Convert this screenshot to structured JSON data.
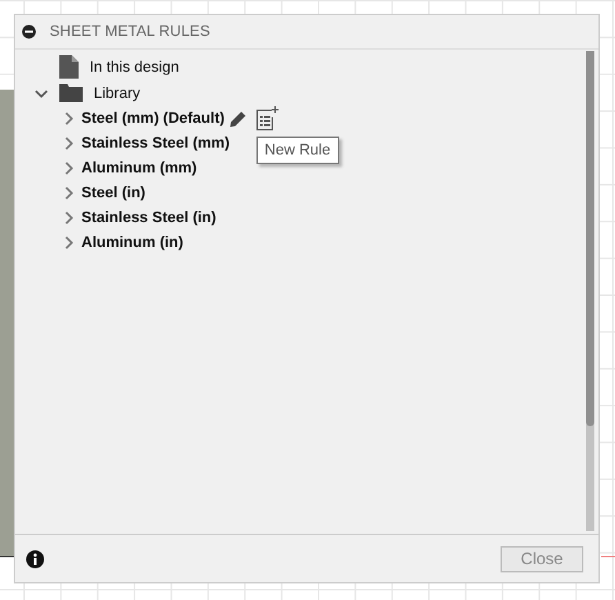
{
  "dialog": {
    "title": "SHEET METAL RULES"
  },
  "tree": [
    {
      "kind": "document",
      "label": "In this design"
    },
    {
      "kind": "folder",
      "label": "Library",
      "expanded": true,
      "children": [
        {
          "label": "Steel (mm) (Default)",
          "expanded": false,
          "hovered": true
        },
        {
          "label": "Stainless Steel (mm)",
          "expanded": false,
          "hovered": false
        },
        {
          "label": "Aluminum (mm)",
          "expanded": false,
          "hovered": false
        },
        {
          "label": "Steel (in)",
          "expanded": false,
          "hovered": false
        },
        {
          "label": "Stainless Steel (in)",
          "expanded": false,
          "hovered": false
        },
        {
          "label": "Aluminum (in)",
          "expanded": false,
          "hovered": false
        }
      ]
    }
  ],
  "tooltip": {
    "text": "New Rule"
  },
  "buttons": [
    {
      "label": "Close",
      "disabled": true
    }
  ]
}
